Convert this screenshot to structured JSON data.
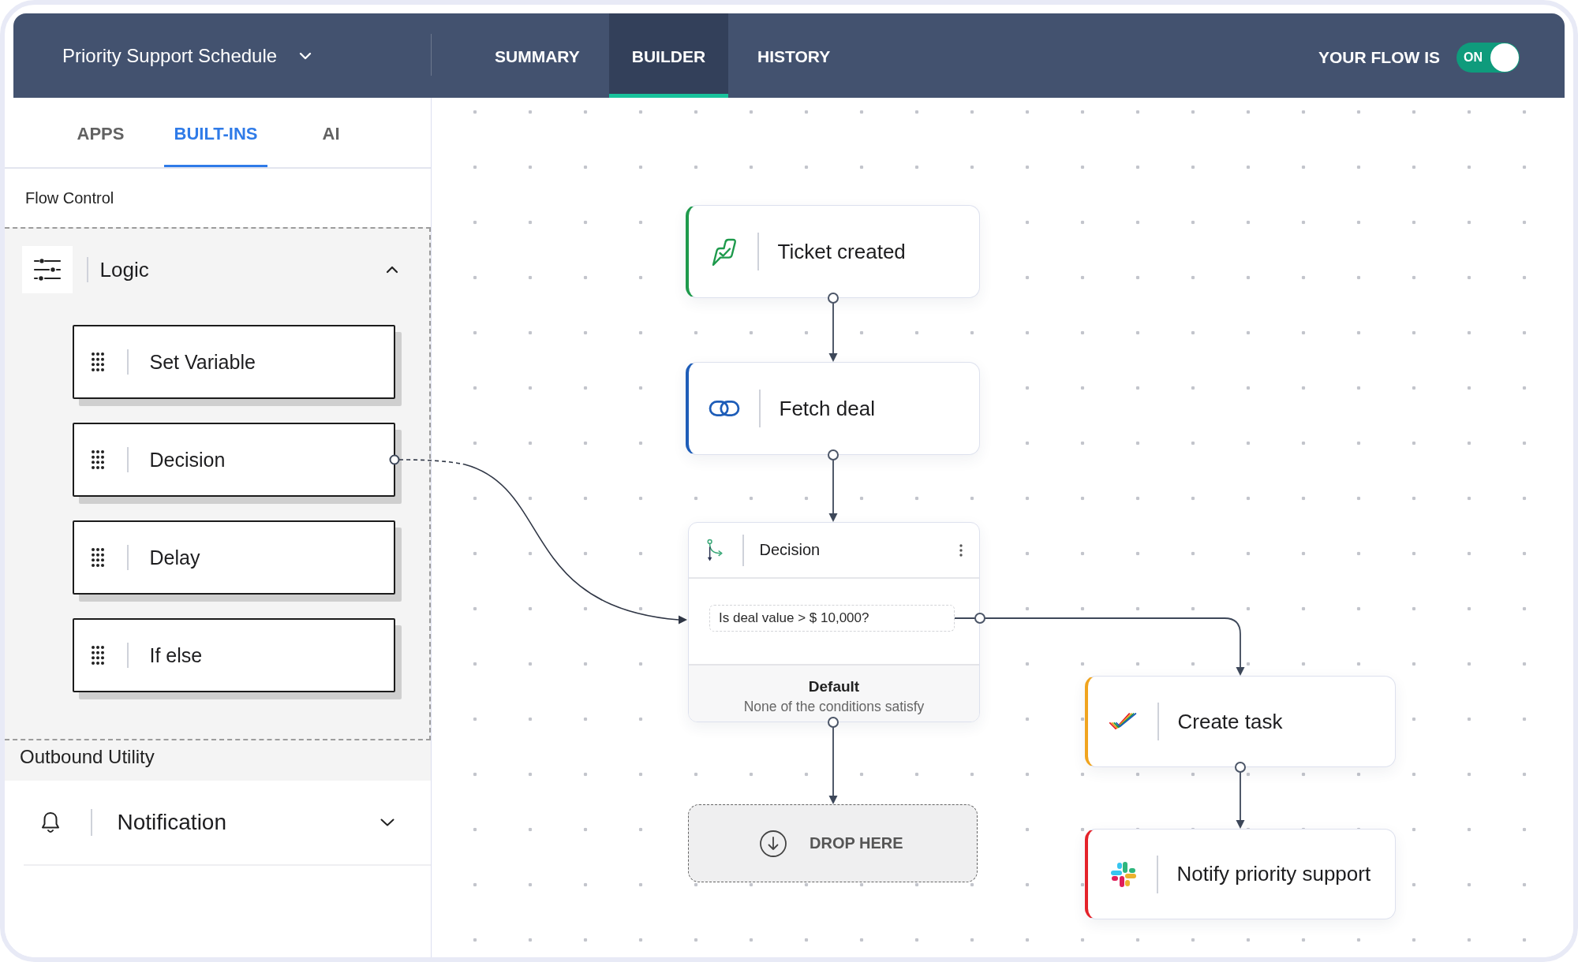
{
  "header": {
    "flow_name": "Priority Support Schedule",
    "tabs": [
      {
        "label": "SUMMARY",
        "selected": false
      },
      {
        "label": "BUILDER",
        "selected": true
      },
      {
        "label": "HISTORY",
        "selected": false
      }
    ],
    "flow_status": {
      "label": "YOUR FLOW IS",
      "toggle_text": "ON",
      "on": true
    }
  },
  "sidebar": {
    "tabs": [
      {
        "label": "APPS",
        "selected": false
      },
      {
        "label": "BUILT-INS",
        "selected": true
      },
      {
        "label": "AI",
        "selected": false
      }
    ],
    "sections": [
      {
        "title": "Flow Control",
        "groups": [
          {
            "kind": "logic",
            "name": "Logic",
            "expanded": true,
            "items": [
              {
                "label": "Set Variable",
                "dragging": false
              },
              {
                "label": "Decision",
                "dragging": true
              },
              {
                "label": "Delay",
                "dragging": false
              },
              {
                "label": "If else",
                "dragging": false
              }
            ]
          }
        ]
      },
      {
        "title": "Outbound Utility",
        "groups": [
          {
            "kind": "notification",
            "name": "Notification",
            "expanded": false
          }
        ]
      }
    ]
  },
  "canvas": {
    "nodes": [
      {
        "kind": "step",
        "title": "Ticket created",
        "color": "#1e9a4c"
      },
      {
        "kind": "step",
        "title": "Fetch deal",
        "color": "#1e5db8"
      },
      {
        "kind": "decision",
        "title": "Decision",
        "conditions": [
          {
            "text": "Is deal value > $ 10,000?"
          }
        ],
        "default": {
          "title": "Default",
          "note": "None of the conditions satisfy"
        }
      },
      {
        "kind": "drop_zone",
        "label": "DROP HERE"
      },
      {
        "kind": "step",
        "title": "Create task",
        "color": "#f0a41e"
      },
      {
        "kind": "step",
        "title": "Notify priority support",
        "color": "#e4222a"
      }
    ]
  }
}
